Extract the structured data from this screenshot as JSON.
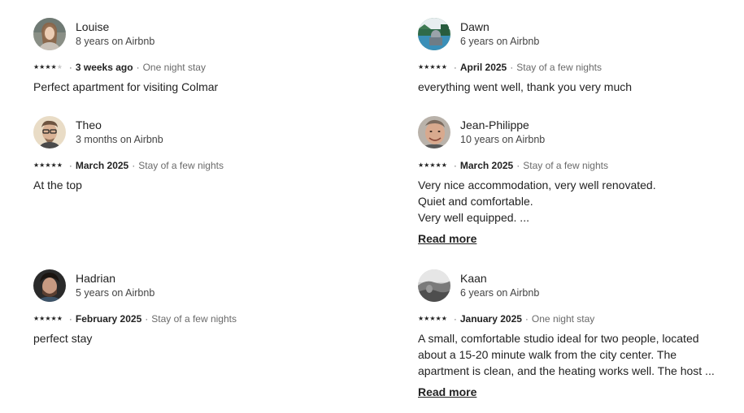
{
  "reviews": [
    {
      "name": "Louise",
      "tenure": "8 years on Airbnb",
      "rating": 4,
      "date": "3 weeks ago",
      "stay": "One night stay",
      "lines": [
        "Perfect apartment for visiting Colmar"
      ],
      "read_more": ""
    },
    {
      "name": "Dawn",
      "tenure": "6 years on Airbnb",
      "rating": 5,
      "date": "April 2025",
      "stay": "Stay of a few nights",
      "lines": [
        "everything went well, thank you very much"
      ],
      "read_more": ""
    },
    {
      "name": "Theo",
      "tenure": "3 months on Airbnb",
      "rating": 5,
      "date": "March 2025",
      "stay": "Stay of a few nights",
      "lines": [
        "At the top"
      ],
      "read_more": ""
    },
    {
      "name": "Jean-Philippe",
      "tenure": "10 years on Airbnb",
      "rating": 5,
      "date": "March 2025",
      "stay": "Stay of a few nights",
      "lines": [
        "Very nice accommodation, very well renovated.",
        "Quiet and comfortable.",
        "Very well equipped. ..."
      ],
      "read_more": "Read more"
    },
    {
      "name": "Hadrian",
      "tenure": "5 years on Airbnb",
      "rating": 5,
      "date": "February 2025",
      "stay": "Stay of a few nights",
      "lines": [
        "perfect stay"
      ],
      "read_more": ""
    },
    {
      "name": "Kaan",
      "tenure": "6 years on Airbnb",
      "rating": 5,
      "date": "January 2025",
      "stay": "One night stay",
      "lines": [
        "A small, comfortable studio ideal for two people, located",
        "about a 15-20 minute walk from the city center. The",
        "apartment is clean, and the heating works well. The host ..."
      ],
      "read_more": "Read more"
    }
  ],
  "separator": "·",
  "star_glyph": "★"
}
